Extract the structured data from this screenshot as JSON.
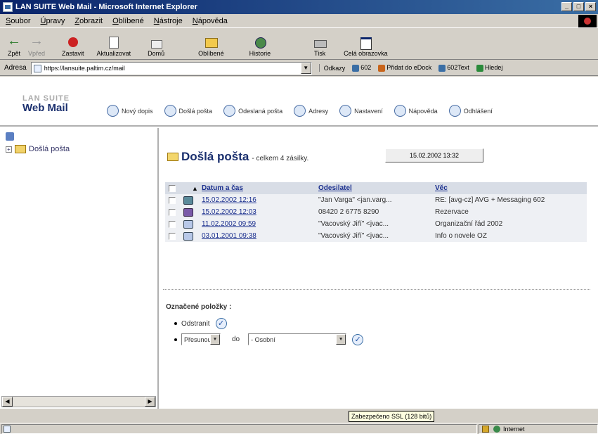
{
  "window": {
    "title": "LAN SUITE Web Mail - Microsoft Internet Explorer"
  },
  "menu": [
    "Soubor",
    "Úpravy",
    "Zobrazit",
    "Oblíbené",
    "Nástroje",
    "Nápověda"
  ],
  "toolbar": {
    "back": "Zpět",
    "forward": "Vpřed",
    "stop": "Zastavit",
    "refresh": "Aktualizovat",
    "home": "Domů",
    "favorites": "Oblíbené",
    "history": "Historie",
    "print": "Tisk",
    "fullscreen": "Celá obrazovka"
  },
  "address": {
    "label": "Adresa",
    "url": "https://lansuite.paltim.cz/mail",
    "links_label": "Odkazy",
    "links": [
      "602",
      "Přidat do eDock",
      "602Text",
      "Hledej"
    ]
  },
  "app": {
    "logo_suite": "LAN SUITE",
    "logo_webmail": "Web Mail",
    "nav": [
      "Nový dopis",
      "Došlá pošta",
      "Odeslaná pošta",
      "Adresy",
      "Nastavení",
      "Nápověda",
      "Odhlášení"
    ]
  },
  "sidebar": {
    "folder": "Došlá pošta"
  },
  "inbox": {
    "title": "Došlá pošta",
    "subtitle": "- celkem 4 zásilky.",
    "datetime": "15.02.2002 13:32",
    "columns": {
      "date": "Datum a čas",
      "from": "Odesilatel",
      "subject": "Věc"
    },
    "rows": [
      {
        "icon": "reply-icon",
        "date": "15.02.2002 12:16",
        "from": "\"Jan Varga\" <jan.varg...",
        "subject": "RE: [avg-cz] AVG + Messaging 602"
      },
      {
        "icon": "fax-icon",
        "date": "15.02.2002 12:03",
        "from": "08420 2 6775 8290",
        "subject": "Rezervace"
      },
      {
        "icon": "read-mail-icon",
        "date": "11.02.2002 09:59",
        "from": "\"Vacovský Jiří\" <jvac...",
        "subject": "Organizační řád 2002"
      },
      {
        "icon": "read-mail-icon",
        "date": "03.01.2001 09:38",
        "from": "\"Vacovský Jiří\" <jvac...",
        "subject": "Info o novele OZ"
      }
    ]
  },
  "marked": {
    "title": "Označené položky :",
    "delete": "Odstranit",
    "move_action": "Přesunout",
    "to_label": "do",
    "target_folder": "- Osobní"
  },
  "tooltip": "Zabezpečeno SSL (128 bitů)",
  "status": {
    "zone": "Internet"
  }
}
